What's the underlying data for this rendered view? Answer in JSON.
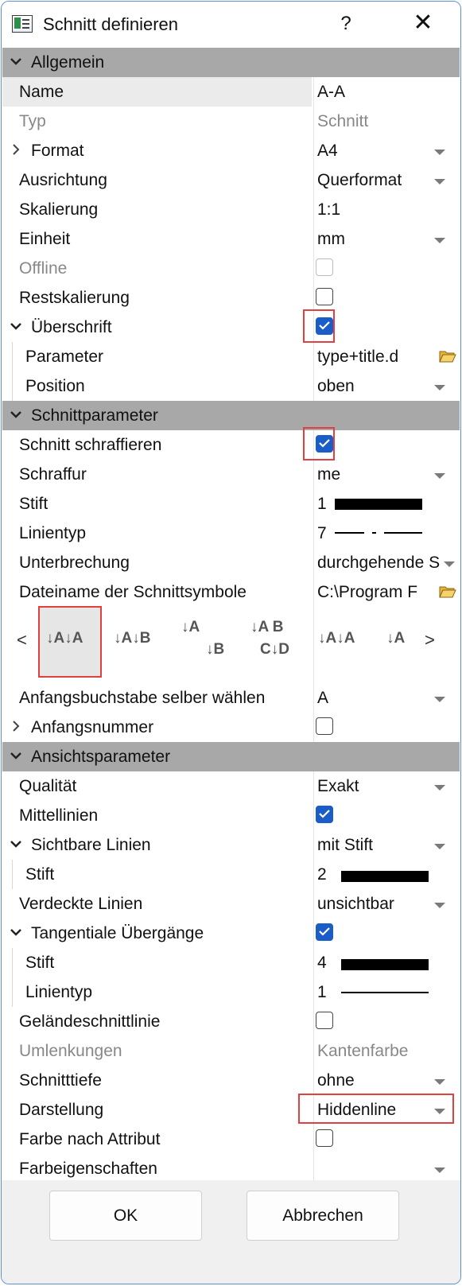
{
  "dialog": {
    "title": "Schnitt definieren",
    "help_label": "?",
    "close_label": "✕"
  },
  "sections": {
    "allgemein": "Allgemein",
    "schnittparameter": "Schnittparameter",
    "ansichtsparameter": "Ansichtsparameter"
  },
  "rows": {
    "name": {
      "label": "Name",
      "value": "A-A"
    },
    "typ": {
      "label": "Typ",
      "value": "Schnitt"
    },
    "format": {
      "label": "Format",
      "value": "A4"
    },
    "ausrichtung": {
      "label": "Ausrichtung",
      "value": "Querformat"
    },
    "skalierung": {
      "label": "Skalierung",
      "value": "1:1"
    },
    "einheit": {
      "label": "Einheit",
      "value": "mm"
    },
    "offline": {
      "label": "Offline",
      "checked": false,
      "disabled": true
    },
    "restskalierung": {
      "label": "Restskalierung",
      "checked": false
    },
    "ueberschrift": {
      "label": "Überschrift",
      "checked": true
    },
    "parameter": {
      "label": "Parameter",
      "value": "type+title.d"
    },
    "position": {
      "label": "Position",
      "value": "oben"
    },
    "schnitt_schraffieren": {
      "label": "Schnitt schraffieren",
      "checked": true
    },
    "schraffur": {
      "label": "Schraffur",
      "value": "me"
    },
    "stift": {
      "label": "Stift",
      "value": "1"
    },
    "linientyp": {
      "label": "Linientyp",
      "value": "7"
    },
    "unterbrechung": {
      "label": "Unterbrechung",
      "value": "durchgehende S"
    },
    "dateiname": {
      "label": "Dateiname der Schnittsymbole",
      "value": "C:\\Program F"
    },
    "anfangsbuchstabe": {
      "label": "Anfangsbuchstabe selber wählen",
      "value": "A"
    },
    "anfangsnummer": {
      "label": "Anfangsnummer",
      "checked": false
    },
    "qualitaet": {
      "label": "Qualität",
      "value": "Exakt"
    },
    "mittellinien": {
      "label": "Mittellinien",
      "checked": true
    },
    "sichtbare_linien": {
      "label": "Sichtbare Linien",
      "value": "mit Stift"
    },
    "sichtbare_stift": {
      "label": "Stift",
      "value": "2"
    },
    "verdeckte_linien": {
      "label": "Verdeckte Linien",
      "value": "unsichtbar"
    },
    "tangentiale": {
      "label": "Tangentiale Übergänge",
      "checked": true
    },
    "tangentiale_stift": {
      "label": "Stift",
      "value": "4"
    },
    "tangentiale_linientyp": {
      "label": "Linientyp",
      "value": "1"
    },
    "gelaendeschnittlinie": {
      "label": "Geländeschnittlinie",
      "checked": false
    },
    "umlenkungen": {
      "label": "Umlenkungen",
      "value": "Kantenfarbe"
    },
    "schnitttiefe": {
      "label": "Schnitttiefe",
      "value": "ohne"
    },
    "darstellung": {
      "label": "Darstellung",
      "value": "Hiddenline"
    },
    "farbe_nach_attribut": {
      "label": "Farbe nach Attribut",
      "checked": false
    },
    "farbeigenschaften": {
      "label": "Farbeigenschaften",
      "value": ""
    }
  },
  "symbols": {
    "prev": "<",
    "next": ">",
    "items": [
      {
        "line1": "↓A↓A",
        "line2": ""
      },
      {
        "line1": "↓A↓B",
        "line2": ""
      },
      {
        "line1": "↓A",
        "line2": "↓B"
      },
      {
        "line1": "↓A B",
        "line2": "C↓D"
      },
      {
        "line1": "↓A↓A",
        "line2": ""
      },
      {
        "line1": "↓A",
        "line2": ""
      }
    ]
  },
  "buttons": {
    "ok": "OK",
    "cancel": "Abbrechen"
  },
  "colors": {
    "accent": "#1a5cc8",
    "section_bg": "#a8a8a8",
    "highlight_box": "#e04040"
  }
}
